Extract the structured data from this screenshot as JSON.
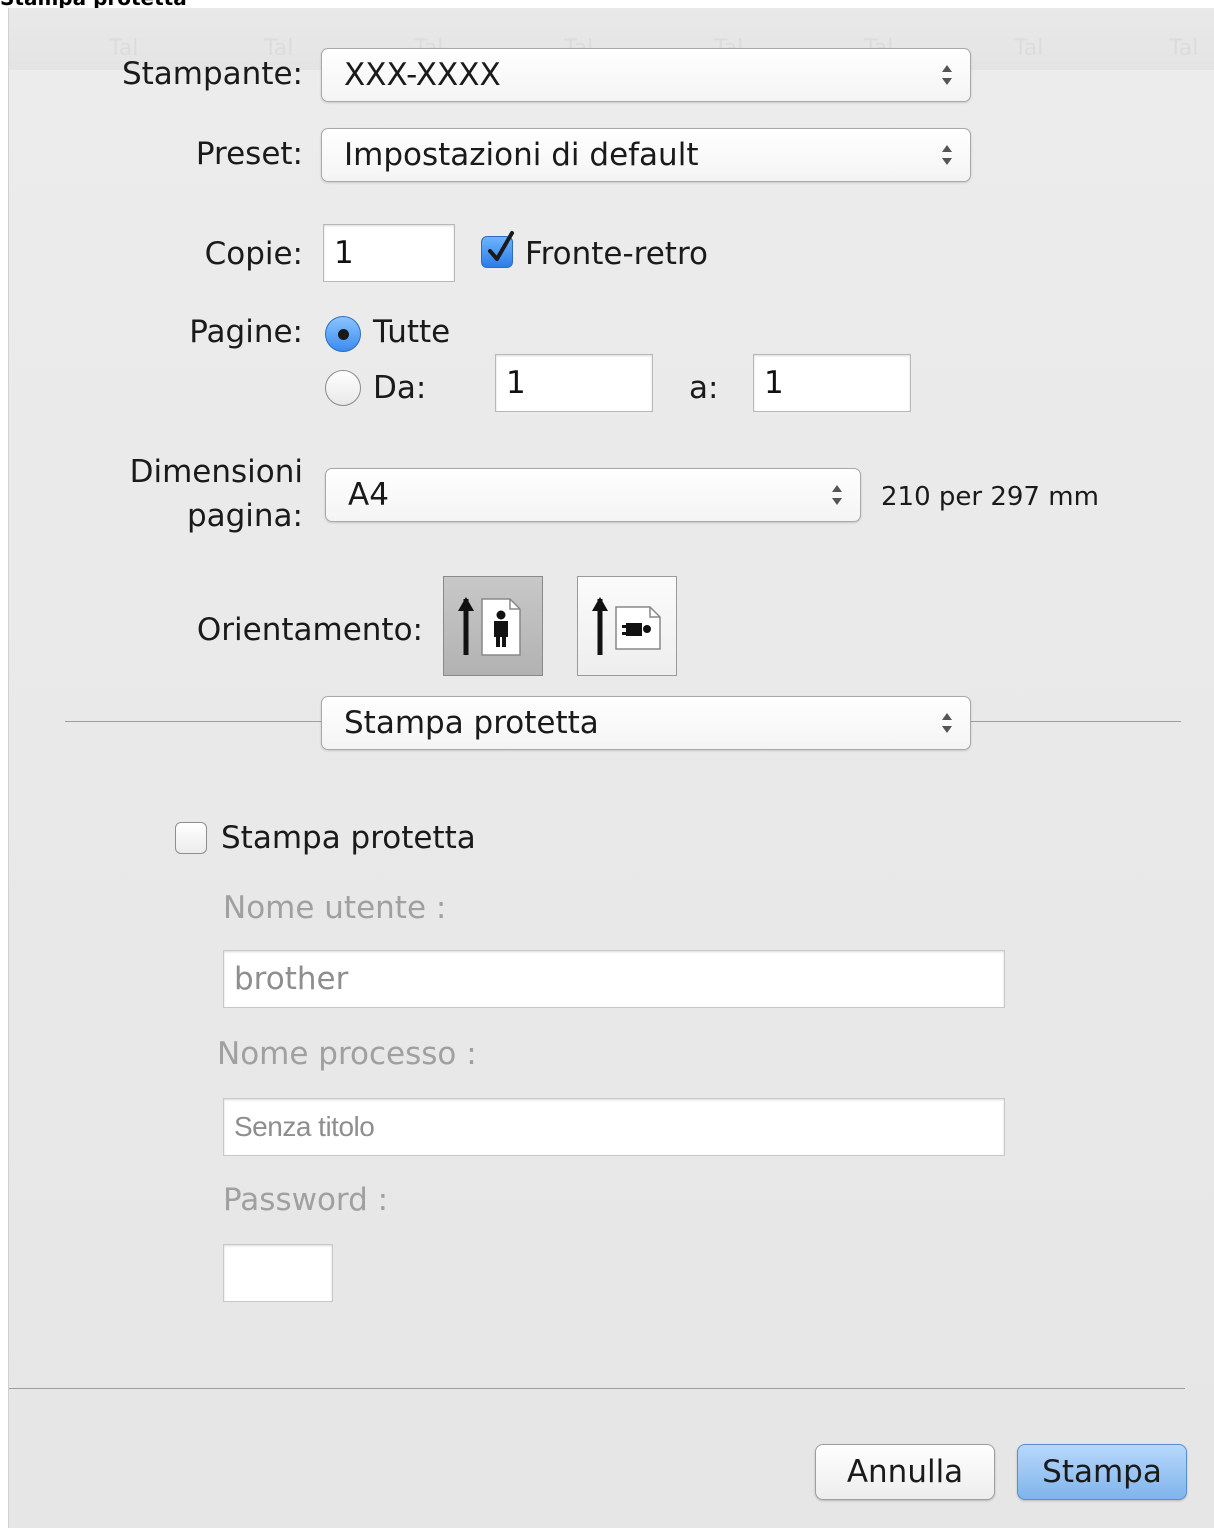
{
  "caption": "Stampa protetta",
  "toolbar_ghost_tabs": [
    "Tal",
    "Tal",
    "Tal",
    "Tal",
    "Tal",
    "Tal",
    "Tal",
    "Tal"
  ],
  "printer": {
    "label": "Stampante:",
    "value": "XXX-XXXX"
  },
  "preset": {
    "label": "Preset:",
    "value": "Impostazioni di default"
  },
  "copies": {
    "label": "Copie:",
    "value": "1",
    "duplex_label": "Fronte-retro",
    "duplex_checked": true
  },
  "pages": {
    "label": "Pagine:",
    "all_label": "Tutte",
    "range_label": "Da:",
    "from_value": "1",
    "to_label": "a:",
    "to_value": "1",
    "selected": "all"
  },
  "paper_size": {
    "label_line1": "Dimensioni",
    "label_line2": "pagina:",
    "value": "A4",
    "dimensions": "210 per 297 mm"
  },
  "orientation": {
    "label": "Orientamento:",
    "selected": "portrait"
  },
  "section_popup": {
    "value": "Stampa protetta"
  },
  "secure": {
    "checkbox_label": "Stampa protetta",
    "checked": false,
    "user_label": "Nome utente :",
    "user_value": "brother",
    "job_label": "Nome processo :",
    "job_value": "Senza titolo",
    "password_label": "Password :",
    "password_value": ""
  },
  "buttons": {
    "cancel": "Annulla",
    "print": "Stampa"
  }
}
